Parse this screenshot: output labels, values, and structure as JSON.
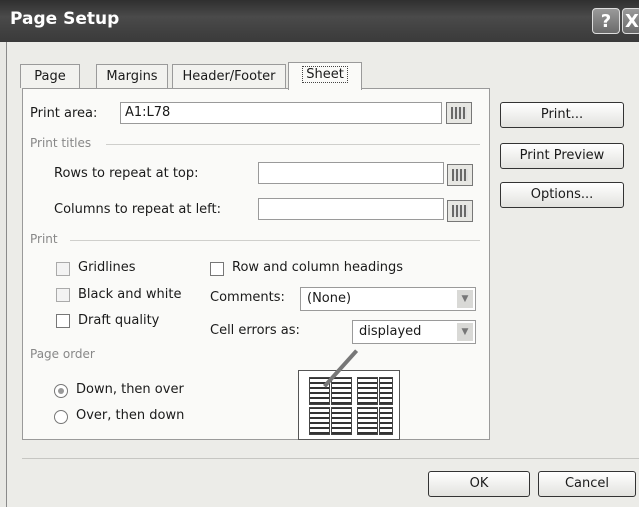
{
  "window": {
    "title": "Page Setup",
    "help_glyph": "?",
    "close_glyph": "X"
  },
  "tabs": [
    {
      "label": "Page"
    },
    {
      "label": "Margins"
    },
    {
      "label": "Header/Footer"
    },
    {
      "label": "Sheet"
    }
  ],
  "print_area": {
    "label": "Print area:",
    "value": "A1:L78"
  },
  "print_titles": {
    "section": "Print titles",
    "rows_label": "Rows to repeat at top:",
    "rows_value": "",
    "cols_label": "Columns to repeat at left:",
    "cols_value": ""
  },
  "print_section": {
    "section": "Print",
    "gridlines": "Gridlines",
    "black_white": "Black and white",
    "draft": "Draft quality",
    "row_col_headings": "Row and column headings",
    "comments_label": "Comments:",
    "comments_value": "(None)",
    "cell_errors_label": "Cell errors as:",
    "cell_errors_value": "displayed"
  },
  "page_order": {
    "section": "Page order",
    "down_over": "Down, then over",
    "over_down": "Over, then down",
    "selected": "down_over"
  },
  "side_buttons": {
    "print": "Print...",
    "preview": "Print Preview",
    "options": "Options..."
  },
  "footer": {
    "ok": "OK",
    "cancel": "Cancel"
  }
}
